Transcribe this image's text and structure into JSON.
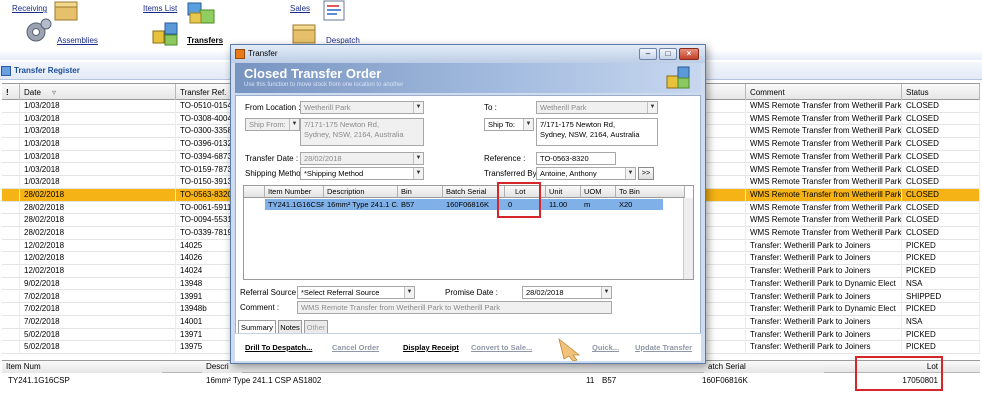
{
  "nav": {
    "receiving": "Receiving",
    "items_list": "Items List",
    "sales": "Sales",
    "assemblies": "Assemblies",
    "transfers": "Transfers",
    "despatch": "Despatch"
  },
  "register": {
    "title": "Transfer Register"
  },
  "grid": {
    "headers": [
      "!",
      "Date",
      "Transfer Ref.",
      "Comment",
      "Status"
    ],
    "rows": [
      {
        "date": "1/03/2018",
        "ref": "TO-0510-0154",
        "comment": "WMS Remote Transfer from Wetherill Park to Wethe",
        "status": "CLOSED"
      },
      {
        "date": "1/03/2018",
        "ref": "TO-0308-4004",
        "comment": "WMS Remote Transfer from Wetherill Park to Wethe",
        "status": "CLOSED"
      },
      {
        "date": "1/03/2018",
        "ref": "TO-0300-3358",
        "comment": "WMS Remote Transfer from Wetherill Park to Wethe",
        "status": "CLOSED"
      },
      {
        "date": "1/03/2018",
        "ref": "TO-0396-0132",
        "comment": "WMS Remote Transfer from Wetherill Park to Wethe",
        "status": "CLOSED"
      },
      {
        "date": "1/03/2018",
        "ref": "TO-0394-6873",
        "comment": "WMS Remote Transfer from Wetherill Park to Wethe",
        "status": "CLOSED"
      },
      {
        "date": "1/03/2018",
        "ref": "TO-0159-7873",
        "comment": "WMS Remote Transfer from Wetherill Park to Wethe",
        "status": "CLOSED"
      },
      {
        "date": "1/03/2018",
        "ref": "TO-0150-3913",
        "comment": "WMS Remote Transfer from Wetherill Park to Wethe",
        "status": "CLOSED"
      },
      {
        "date": "28/02/2018",
        "ref": "TO-0563-8320",
        "comment": "WMS Remote Transfer from Wetherill Park to Wethe",
        "status": "CLOSED"
      },
      {
        "date": "28/02/2018",
        "ref": "TO-0061-5911",
        "comment": "WMS Remote Transfer from Wetherill Park to Wethe",
        "status": "CLOSED"
      },
      {
        "date": "28/02/2018",
        "ref": "TO-0094-5531",
        "comment": "WMS Remote Transfer from Wetherill Park to Wethe",
        "status": "CLOSED"
      },
      {
        "date": "28/02/2018",
        "ref": "TO-0339-7819",
        "comment": "WMS Remote Transfer from Wetherill Park to Wethe",
        "status": "CLOSED"
      },
      {
        "date": "12/02/2018",
        "ref": "14025",
        "comment": "Transfer: Wetherill Park to Joiners",
        "status": "PICKED"
      },
      {
        "date": "12/02/2018",
        "ref": "14026",
        "comment": "Transfer: Wetherill Park to Joiners",
        "status": "PICKED"
      },
      {
        "date": "12/02/2018",
        "ref": "14024",
        "comment": "Transfer: Wetherill Park to Joiners",
        "status": "PICKED"
      },
      {
        "date": "9/02/2018",
        "ref": "13948",
        "comment": "Transfer: Wetherill Park to Dynamic Elect",
        "status": "NSA"
      },
      {
        "date": "7/02/2018",
        "ref": "13991",
        "comment": "Transfer: Wetherill Park to Joiners",
        "status": "SHIPPED"
      },
      {
        "date": "7/02/2018",
        "ref": "13948b",
        "comment": "Transfer: Wetherill Park to Dynamic Elect",
        "status": "PICKED"
      },
      {
        "date": "7/02/2018",
        "ref": "14001",
        "comment": "Transfer: Wetherill Park to Joiners",
        "status": "NSA"
      },
      {
        "date": "5/02/2018",
        "ref": "13971",
        "comment": "Transfer: Wetherill Park to Joiners",
        "status": "PICKED"
      },
      {
        "date": "5/02/2018",
        "ref": "13975",
        "comment": "Transfer: Wetherill Park to Joiners",
        "status": "PICKED"
      }
    ]
  },
  "detail": {
    "headers": {
      "item_num": "Item Num",
      "desc": "Descri",
      "batch": "atch Serial",
      "lot": "Lot"
    },
    "row": {
      "item_num": "TY241.1G16CSP",
      "desc": "16mm² Type 241.1 CSP AS1802",
      "qty": "11",
      "bin": "B57",
      "batch": "160F06816K",
      "lot": "17050801"
    }
  },
  "dialog": {
    "window_title": "Transfer",
    "banner_title": "Closed Transfer Order",
    "banner_subtitle": "Use this function to move stock from one location to another",
    "from_location_label": "From Location :",
    "from_location": "Wetherill Park",
    "to_label": "To :",
    "to_location": "Wetherill Park",
    "ship_from_label": "Ship From:",
    "ship_from_address_1": "7/171-175 Newton Rd,",
    "ship_from_address_2": "Sydney, NSW, 2164, Australia",
    "ship_to_label": "Ship To:",
    "ship_to_address_1": "7/171-175 Newton Rd,",
    "ship_to_address_2": "Sydney, NSW, 2164, Australia",
    "transfer_date_label": "Transfer Date :",
    "transfer_date": "28/02/2018",
    "reference_label": "Reference :",
    "reference": "TO-0563-8320",
    "shipping_method_label": "Shipping Method :",
    "shipping_method": "*Shipping Method",
    "transferred_by_label": "Transferred By :",
    "transferred_by": "Antoine, Anthony",
    "more_button": ">>",
    "lines_headers": [
      "Item Number",
      "Description",
      "Bin",
      "Batch Serial",
      "Lot",
      "Unit",
      "UOM",
      "To Bin"
    ],
    "line": {
      "item": "TY241.1G16CSP",
      "desc": "16mm² Type 241.1 C...",
      "bin": "B57",
      "batch": "160F06816K",
      "lot": "0",
      "unit": "11.00",
      "uom": "m",
      "to_bin": "X20"
    },
    "referral_source_label": "Referral Source :",
    "referral_source": "*Select Referral Source",
    "promise_date_label": "Promise Date :",
    "promise_date": "28/02/2018",
    "comment_label": "Comment :",
    "comment": "WMS Remote Transfer from Wetherill Park to Wetherill Park",
    "tabs": [
      "Summary",
      "Notes",
      "Other"
    ],
    "footer": {
      "drill": "Drill To Despatch...",
      "cancel": "Cancel Order",
      "display": "Display Receipt",
      "convert": "Convert to Sale...",
      "quick": "Quick...",
      "update": "Update Transfer"
    }
  },
  "colors": {
    "selected_row": "#f5b316",
    "highlight_box": "#d6262a",
    "line_select": "#7fb0e8"
  }
}
